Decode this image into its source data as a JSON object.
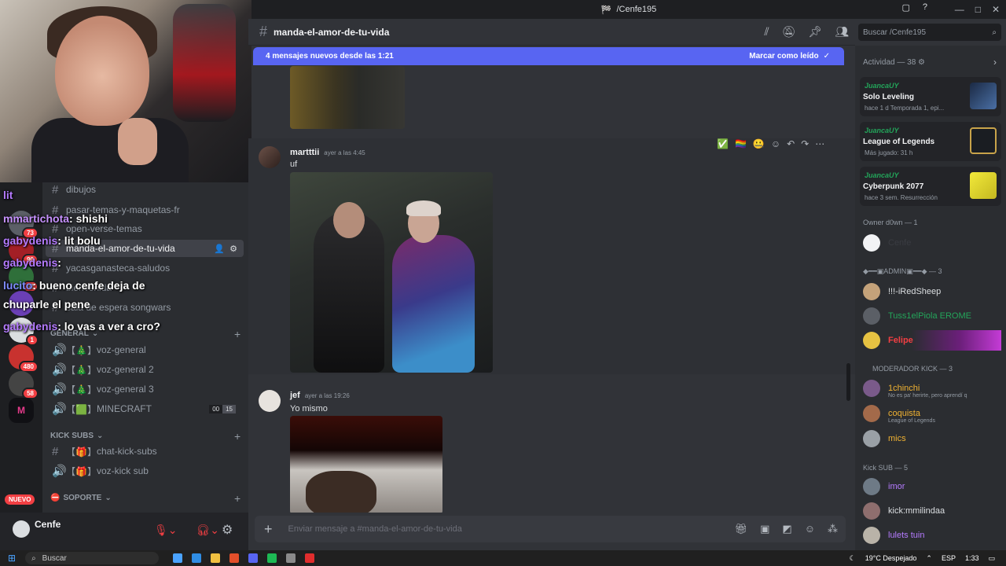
{
  "window": {
    "title": "/Cenfe195"
  },
  "header": {
    "channel": "manda-el-amor-de-tu-vida"
  },
  "search": {
    "placeholder": "Buscar /Cenfe195"
  },
  "banner": {
    "text": "4 mensajes nuevos desde las 1:21",
    "action": "Marcar como leído"
  },
  "channels": {
    "text_channels": [
      "dibujos",
      "pasar-temas-y-maquetas-fr",
      "open-verse-temas",
      "manda-el-amor-de-tu-vida",
      "yacasganasteca-saludos",
      "bienvenida",
      "sala de espera songwars"
    ],
    "categories": {
      "general": "GENERAL",
      "kick_subs": "KICK SUBS",
      "soporte": "SOPORTE"
    },
    "voice": [
      {
        "name": "voz-general",
        "prefix": "【🎄】"
      },
      {
        "name": "voz-general 2",
        "prefix": "【🎄】"
      },
      {
        "name": "voz-general 3",
        "prefix": "【🎄】"
      },
      {
        "name": "MINECRAFT",
        "prefix": "【🟩】",
        "count_a": "00",
        "count_b": "15"
      }
    ],
    "kick": [
      {
        "name": "chat-kick-subs",
        "prefix": "【🎁】"
      },
      {
        "name": "voz-kick sub",
        "prefix": "【🎁】"
      }
    ]
  },
  "chat_overlay": [
    {
      "user": "lit",
      "text": ""
    },
    {
      "user": "mmartichota",
      "text": ": shishi"
    },
    {
      "user": "gabydenis",
      "text": ": lit bolu"
    },
    {
      "user": "gabydenis",
      "text": ":"
    },
    {
      "user": "lucito",
      "text": ": bueno cenfe deja de"
    },
    {
      "user": "",
      "text": "chuparle el pene"
    },
    {
      "user": "gabydenis",
      "text": ": lo vas a ver a cro?"
    }
  ],
  "server_badges": [
    "73",
    "90",
    "32",
    "1",
    "480",
    "58"
  ],
  "server_new": "NUEVO",
  "user": {
    "name": "Cenfe"
  },
  "messages": [
    {
      "author": "martttii",
      "time": "ayer a las 4:45",
      "text": "uf"
    },
    {
      "author": "jef",
      "time": "ayer a las 19:26",
      "text": "Yo mismo"
    }
  ],
  "input": {
    "placeholder": "Enviar mensaje a #manda-el-amor-de-tu-vida"
  },
  "right_panel": {
    "activity_title": "Actividad — 38",
    "activities": [
      {
        "user": "JuancaUY",
        "game": "Solo Leveling",
        "sub": "hace 1 d    Temporada 1, epi...",
        "color": "#3b5b8a"
      },
      {
        "user": "JuancaUY",
        "game": "League of Legends",
        "sub": "Más jugado: 31 h",
        "color": "#c8a34a"
      },
      {
        "user": "JuancaUY",
        "game": "Cyberpunk 2077",
        "sub": "hace 3 sem.   Resurrección",
        "color": "#e3d93a"
      }
    ],
    "sections": [
      {
        "title": "Owner d0wn — 1",
        "members": [
          {
            "name": "Cenfe",
            "color": "#2b2d31",
            "activity": ""
          }
        ]
      },
      {
        "title": "◆━━▣ADMIN▣━━◆ — 3",
        "members": [
          {
            "name": "!!!-iRedSheep",
            "color": "#dbdee1",
            "activity": ""
          },
          {
            "name": "Tuss1elPiola EROME",
            "color": "#23a55a",
            "activity": ""
          },
          {
            "name": "Felipe",
            "color": "#f23f43",
            "activity": ""
          }
        ]
      },
      {
        "title": "MODERADOR KICK — 3",
        "members": [
          {
            "name": "1chinchi",
            "color": "#f0b232",
            "activity": "No es pa' herirte, pero aprendí q"
          },
          {
            "name": "coquista",
            "color": "#f0b232",
            "activity": "League of Legends"
          },
          {
            "name": "mics",
            "color": "#f0b232",
            "activity": ""
          }
        ]
      },
      {
        "title": "Kick SUB — 5",
        "members": [
          {
            "name": "imor",
            "color": "#b57bff",
            "activity": ""
          },
          {
            "name": "kick:mmilindaa",
            "color": "#dbdee1",
            "activity": ""
          },
          {
            "name": "lulets tuin",
            "color": "#b57bff",
            "activity": ""
          }
        ]
      }
    ]
  },
  "taskbar": {
    "search": "Buscar",
    "weather": "19°C  Despejado",
    "lang": "ESP",
    "time": "1:33"
  }
}
